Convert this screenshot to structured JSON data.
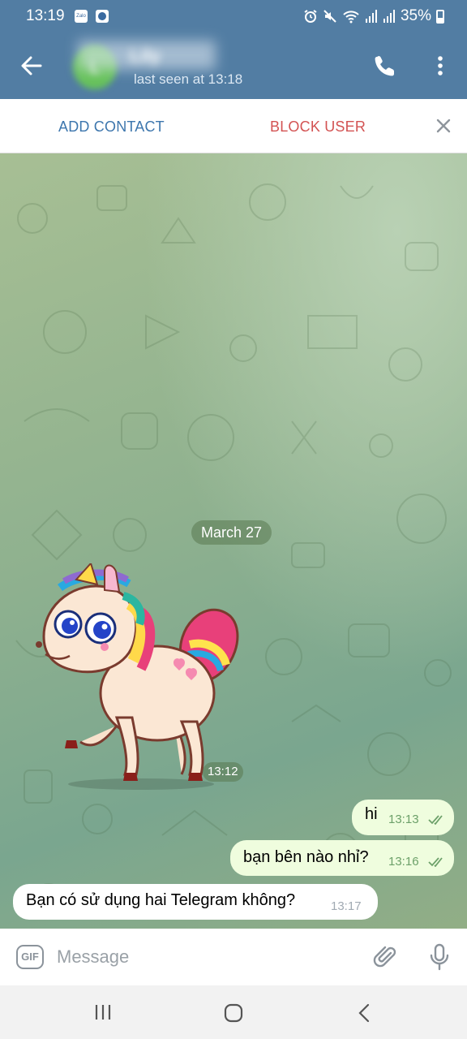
{
  "status_bar": {
    "time": "13:19",
    "app_icons": [
      "Zalo",
      "messenger-icon"
    ],
    "battery": "35%",
    "icons": [
      "alarm-icon",
      "mute-icon",
      "wifi-icon",
      "signal-icon",
      "signal-icon",
      "battery-icon"
    ]
  },
  "header": {
    "contact_name": "Lily",
    "avatar_initials": "L",
    "last_seen": "last seen at 13:18",
    "icons": [
      "back-arrow-icon",
      "phone-icon",
      "more-vert-icon"
    ]
  },
  "action_bar": {
    "add_contact": "ADD CONTACT",
    "block_user": "BLOCK USER"
  },
  "chat": {
    "date_separator": "March 27",
    "sticker": {
      "description": "unicorn-sticker",
      "time": "13:12"
    },
    "messages": [
      {
        "direction": "out",
        "text": "hi",
        "time": "13:13",
        "status": "read"
      },
      {
        "direction": "out",
        "text": "bạn bên nào nhỉ?",
        "time": "13:16",
        "status": "read"
      },
      {
        "direction": "in",
        "text": "Bạn có sử dụng hai Telegram không?",
        "time": "13:17"
      }
    ]
  },
  "input_bar": {
    "gif_label": "GIF",
    "placeholder": "Message",
    "icons": [
      "attach-icon",
      "mic-icon"
    ]
  },
  "colors": {
    "header_bg": "#527da3",
    "outgoing_bubble": "#effdde",
    "incoming_bubble": "#ffffff",
    "add_contact": "#3d76ad",
    "block_user": "#d35353"
  }
}
